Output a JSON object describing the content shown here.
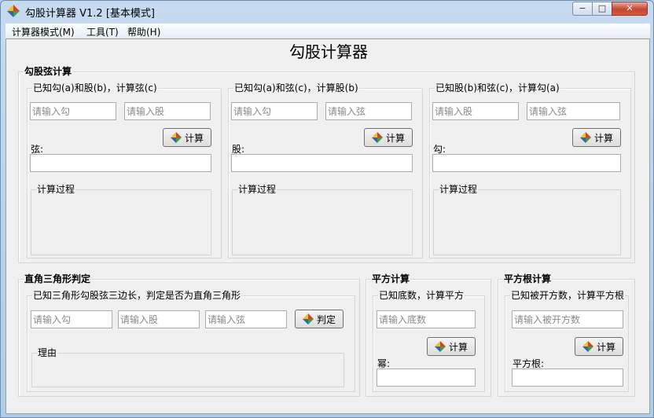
{
  "window": {
    "title": "勾股计算器 V1.2 [基本模式]",
    "caption_min": "−",
    "caption_max": "□",
    "caption_close": "✕"
  },
  "menu": [
    "计算器模式(M)",
    "工具(T)",
    "帮助(H)"
  ],
  "page_title": "勾股计算器",
  "icons": {
    "app": "pinwheel-icon",
    "button": "pinwheel-icon"
  },
  "colors": {
    "red": "#e23a2c",
    "green": "#34a34c",
    "blue": "#2f5fc0",
    "yellow": "#f2c318"
  },
  "pythagoras": {
    "label": "勾股弦计算",
    "panels": [
      {
        "label": "已知勾(a)和股(b)，计算弦(c)",
        "input1_placeholder": "请输入勾",
        "input2_placeholder": "请输入股",
        "button": "计算",
        "result_label": "弦:",
        "process_label": "计算过程"
      },
      {
        "label": "已知勾(a)和弦(c)，计算股(b)",
        "input1_placeholder": "请输入勾",
        "input2_placeholder": "请输入弦",
        "button": "计算",
        "result_label": "股:",
        "process_label": "计算过程"
      },
      {
        "label": "已知股(b)和弦(c)，计算勾(a)",
        "input1_placeholder": "请输入股",
        "input2_placeholder": "请输入弦",
        "button": "计算",
        "result_label": "勾:",
        "process_label": "计算过程"
      }
    ]
  },
  "right_triangle": {
    "label": "直角三角形判定",
    "sub_label": "已知三角形勾股弦三边长，判定是否为直角三角形",
    "placeholders": [
      "请输入勾",
      "请输入股",
      "请输入弦"
    ],
    "button": "判定",
    "reason_label": "理由"
  },
  "square": {
    "label": "平方计算",
    "sub_label": "已知底数，计算平方",
    "placeholder": "请输入底数",
    "button": "计算",
    "result_label": "幂:"
  },
  "sqrt": {
    "label": "平方根计算",
    "sub_label": "已知被开方数，计算平方根",
    "placeholder": "请输入被开方数",
    "button": "计算",
    "result_label": "平方根:"
  }
}
